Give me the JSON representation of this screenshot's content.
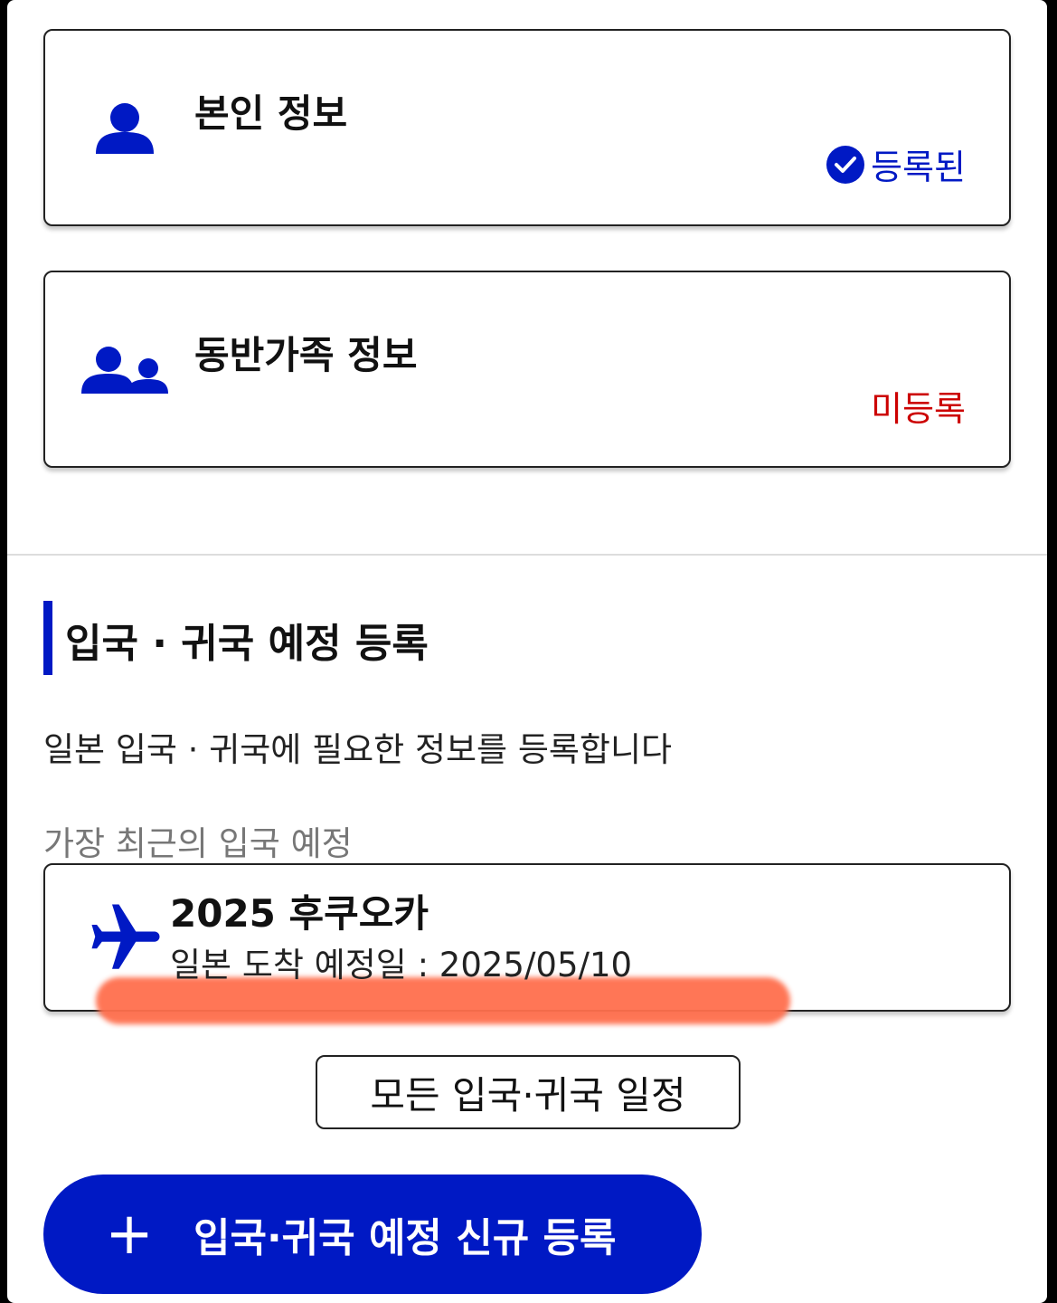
{
  "personal_card": {
    "title": "본인 정보",
    "status": "등록된",
    "status_color": "#0019c4"
  },
  "family_card": {
    "title": "동반가족 정보",
    "status": "미등록",
    "status_color": "#cc0000"
  },
  "section": {
    "title": "입국 · 귀국 예정 등록",
    "description": "일본 입국 · 귀국에 필요한 정보를 등록합니다",
    "recent_label": "가장 최근의 입국 예정"
  },
  "trip": {
    "title": "2025 후쿠오카",
    "arrival_label": "일본 도착 예정일 : 2025/05/10"
  },
  "buttons": {
    "all_schedules": "모든 입국·귀국 일정",
    "new_registration": "입국·귀국 예정 신규 등록",
    "plus_icon": "+"
  },
  "colors": {
    "accent": "#0019c4",
    "highlight": "#ff6f4d"
  },
  "icons": {
    "personal": "person-icon",
    "family": "family-icon",
    "check": "check-circle-icon",
    "trip": "airplane-icon",
    "add": "plus-icon"
  }
}
